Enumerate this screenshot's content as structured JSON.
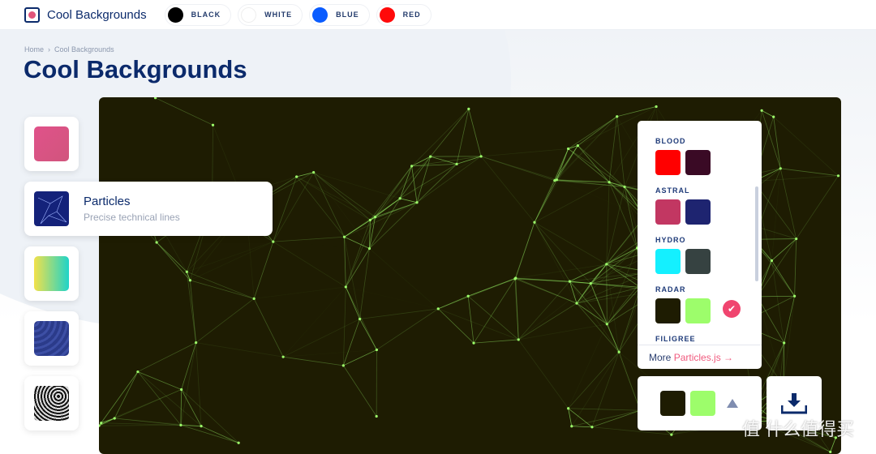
{
  "header": {
    "brand": "Cool Backgrounds",
    "colors": [
      {
        "label": "BLACK",
        "color": "#000000"
      },
      {
        "label": "WHITE",
        "color": "#ffffff"
      },
      {
        "label": "BLUE",
        "color": "#0a5cff"
      },
      {
        "label": "RED",
        "color": "#ff0a0a"
      }
    ]
  },
  "breadcrumb": {
    "home": "Home",
    "sep": "›",
    "current": "Cool Backgrounds"
  },
  "page_title": "Cool Backgrounds",
  "styles": {
    "active": {
      "title": "Particles",
      "subtitle": "Precise technical lines"
    }
  },
  "palette": {
    "groups": [
      {
        "name": "BLOOD",
        "colors": [
          "#ff0000",
          "#3a0a25"
        ]
      },
      {
        "name": "ASTRAL",
        "colors": [
          "#c23762",
          "#1e2470"
        ]
      },
      {
        "name": "HYDRO",
        "colors": [
          "#14f0ff",
          "#364241"
        ]
      },
      {
        "name": "RADAR",
        "colors": [
          "#1e1c02",
          "#9dfd6b"
        ],
        "selected": true
      },
      {
        "name": "FILIGREE",
        "colors": []
      }
    ],
    "more_prefix": "More ",
    "more_link": "Particles.js →"
  },
  "current": {
    "background": "#1e1c02",
    "line": "#9dfd6b"
  },
  "watermark": "值 什么值得买"
}
